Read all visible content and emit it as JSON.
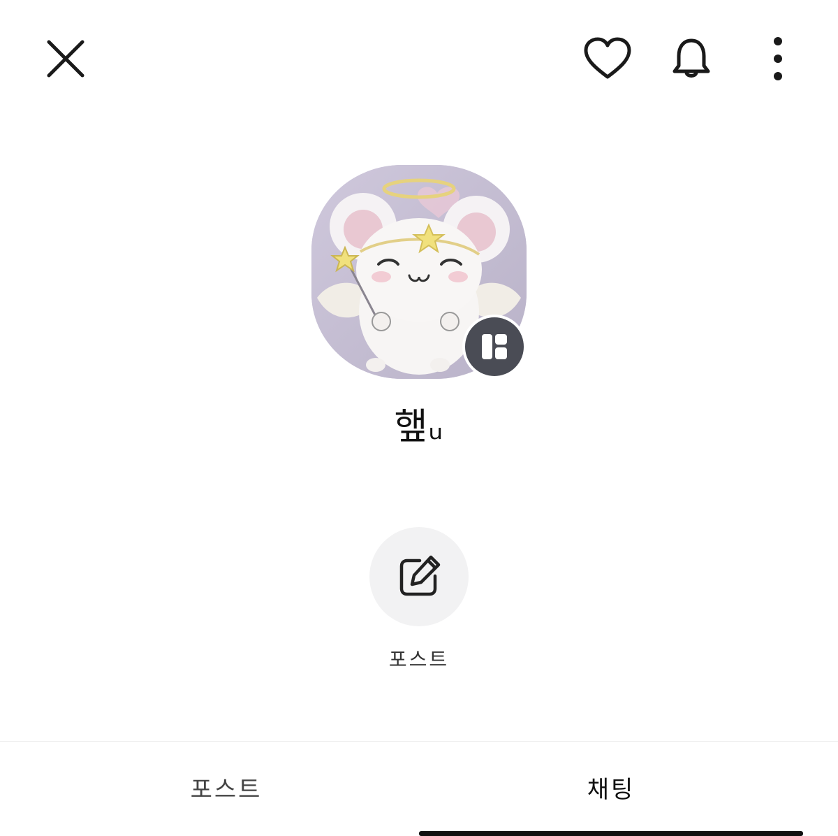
{
  "header": {
    "close_icon": "close-icon",
    "like_icon": "heart-icon",
    "notify_icon": "bell-icon",
    "more_icon": "more-vertical-icon"
  },
  "profile": {
    "username": "햎ᵤ",
    "avatar_icon": "avatar-image",
    "badge_icon": "layout-panel-icon"
  },
  "actions": {
    "post_icon": "edit-square-icon",
    "post_label": "포스트"
  },
  "tabs": [
    {
      "label": "포스트",
      "active": false
    },
    {
      "label": "채팅",
      "active": true
    }
  ],
  "colors": {
    "accent": "#111111",
    "badge": "#4a4c55",
    "action_bg": "#f2f2f3"
  }
}
